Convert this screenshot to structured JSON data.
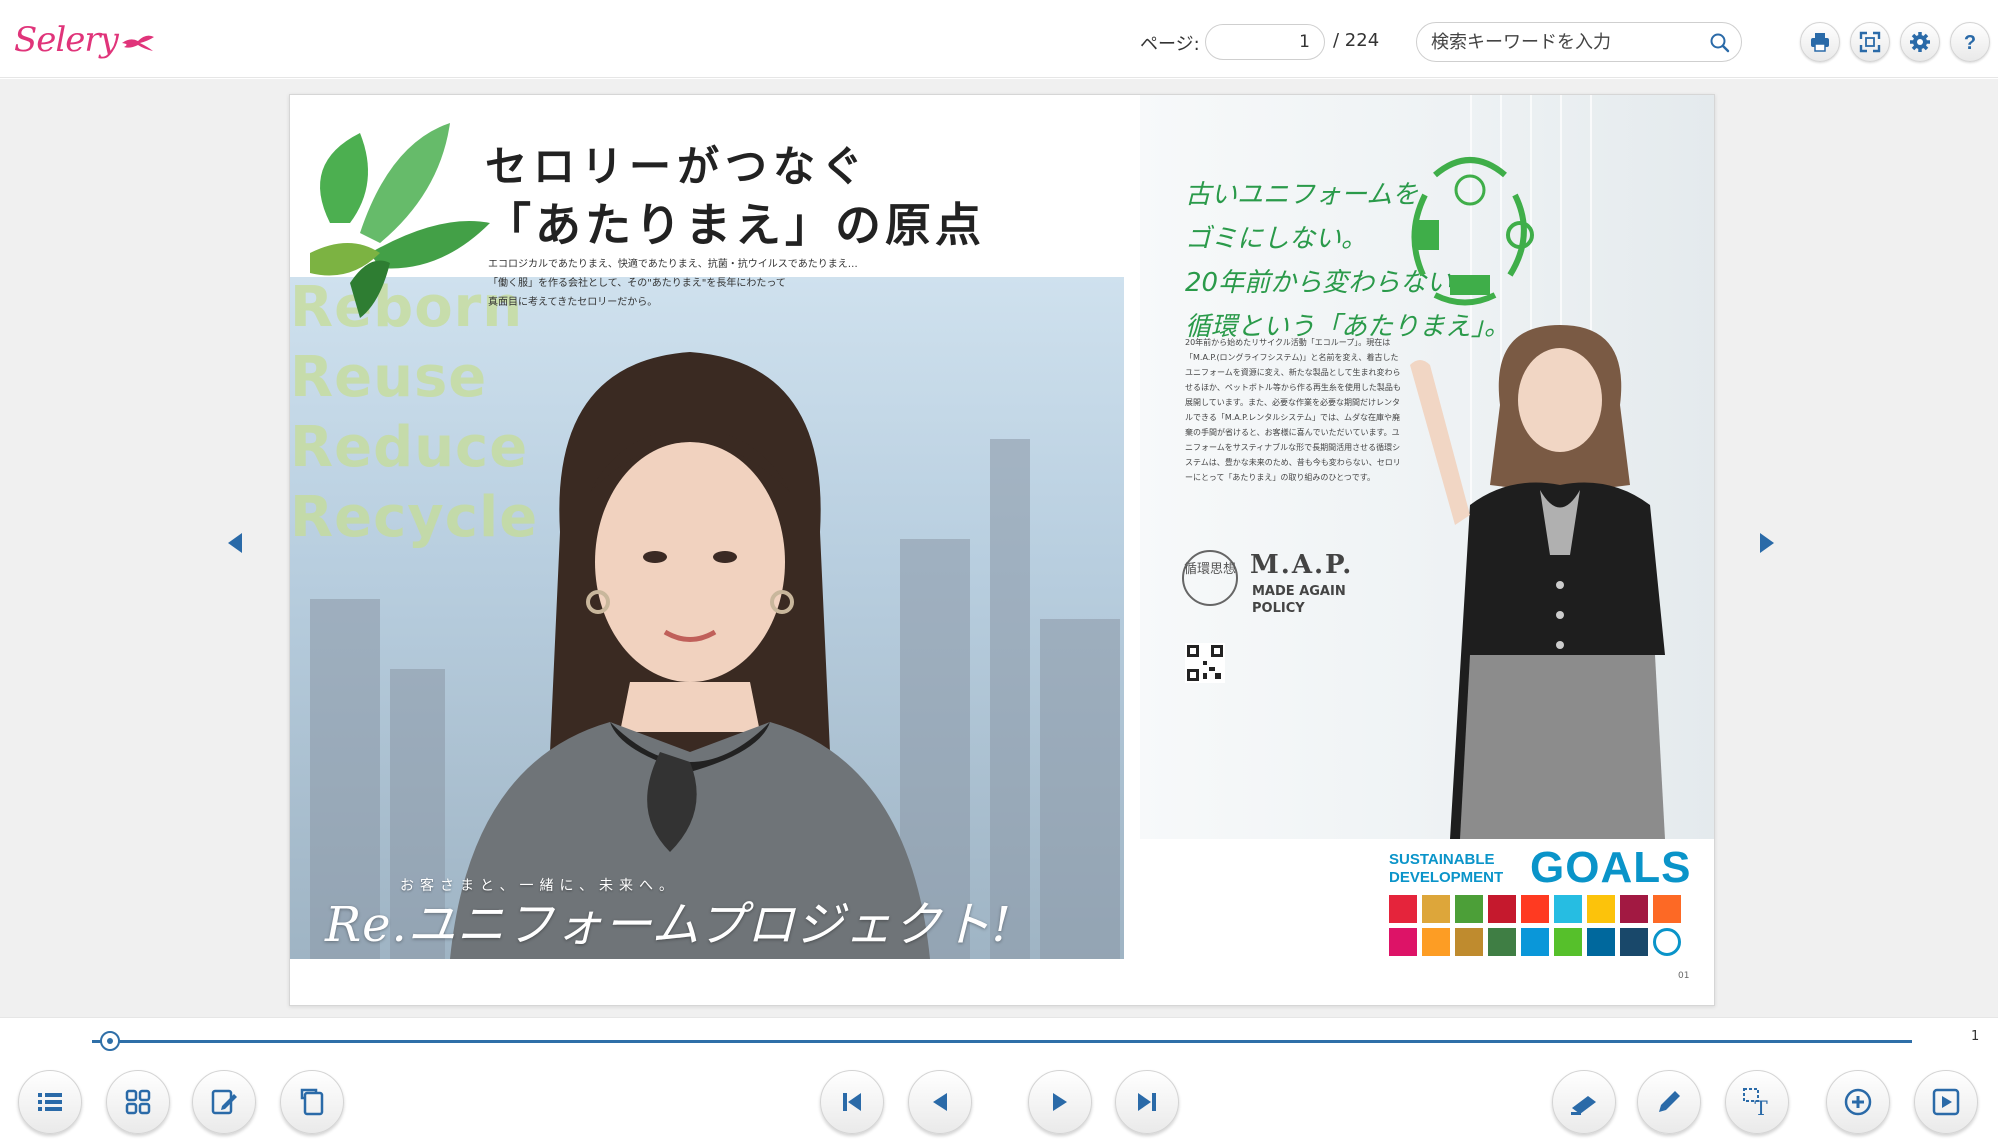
{
  "header": {
    "logo_text": "Selery",
    "page_label": "ページ:",
    "page_value": "1",
    "page_total": "/ 224",
    "search_placeholder": "検索キーワードを入力",
    "icons": [
      "print-icon",
      "fullscreen-icon",
      "settings-icon",
      "help-icon"
    ]
  },
  "viewer": {
    "left_page": {
      "title_line1": "セロリーがつなぐ",
      "title_line2": "「あたりまえ」の原点",
      "subtitle_lines": [
        "エコロジカルであたりまえ、快適であたりまえ、抗菌・抗ウイルスであたりまえ…",
        "「働く服」を作る会社として、その\"あたりまえ\"を長年にわたって",
        "真面目に考えてきたセロリーだから。"
      ],
      "rr_words": [
        "Reborn",
        "Reuse",
        "Reduce",
        "Recycle"
      ],
      "tagline_small": "お客さまと、一緒に、未来へ。",
      "tagline": "Re.ユニフォームプロジェクト!"
    },
    "right_page": {
      "handwritten_lines": [
        "古いユニフォームを",
        "ゴミにしない。",
        "20年前から変わらない、",
        "循環という「あたりまえ」。"
      ],
      "body_text": "20年前から始めたリサイクル活動「エコループ」。現在は「M.A.P.(ロングライフシステム)」と名前を変え、着古したユニフォームを資源に変え、新たな製品として生まれ変わらせるほか、ペットボトル等から作る再生糸を使用した製品も展開しています。また、必要な作業を必要な期間だけレンタルできる「M.A.P.レンタルシステム」では、ムダな在庫や廃棄の手間が省けると、お客様に喜んでいただいています。ユニフォームをサスティナブルな形で長期間活用させる循環システムは、豊かな未来のため、昔も今も変わらない、セロリーにとって「あたりまえ」の取り組みのひとつです。",
      "map_circle": "循環思想",
      "map_title": "M.A.P.",
      "map_sub1": "MADE AGAIN",
      "map_sub2": "POLICY",
      "sdg_small1": "SUSTAINABLE",
      "sdg_small2": "DEVELOPMENT",
      "sdg_big": "GOALS",
      "page_num": "01"
    },
    "sdg_colors": [
      "#e5243b",
      "#dda63a",
      "#4c9f38",
      "#c5192d",
      "#ff3a21",
      "#26bde2",
      "#fcc30b",
      "#a21942",
      "#fd6925",
      "#dd1367",
      "#fd9d24",
      "#bf8b2e",
      "#3f7e44",
      "#0a97d9",
      "#56c02b",
      "#00689d",
      "#19486a",
      "#ffffff"
    ]
  },
  "bottom": {
    "slider_value": "1",
    "progress": 0.0
  }
}
